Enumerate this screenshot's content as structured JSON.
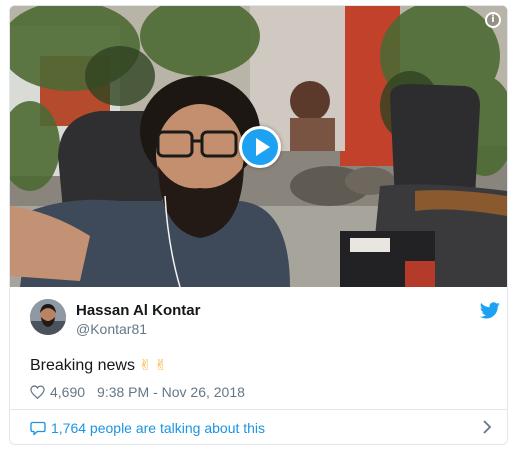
{
  "media": {
    "info_icon": "info-icon",
    "play_icon": "play-icon",
    "info_glyph": "i"
  },
  "author": {
    "name": "Hassan Al Kontar",
    "handle": "@Kontar81",
    "brand_icon": "twitter-bird-icon",
    "brand_color": "#1da1f2"
  },
  "tweet": {
    "text": "Breaking news",
    "emoji": "✌✌",
    "likes": "4,690",
    "timestamp": "9:38 PM - Nov 26, 2018"
  },
  "footer": {
    "talking_text": "1,764 people are talking about this",
    "link_color": "#1b95e0"
  }
}
